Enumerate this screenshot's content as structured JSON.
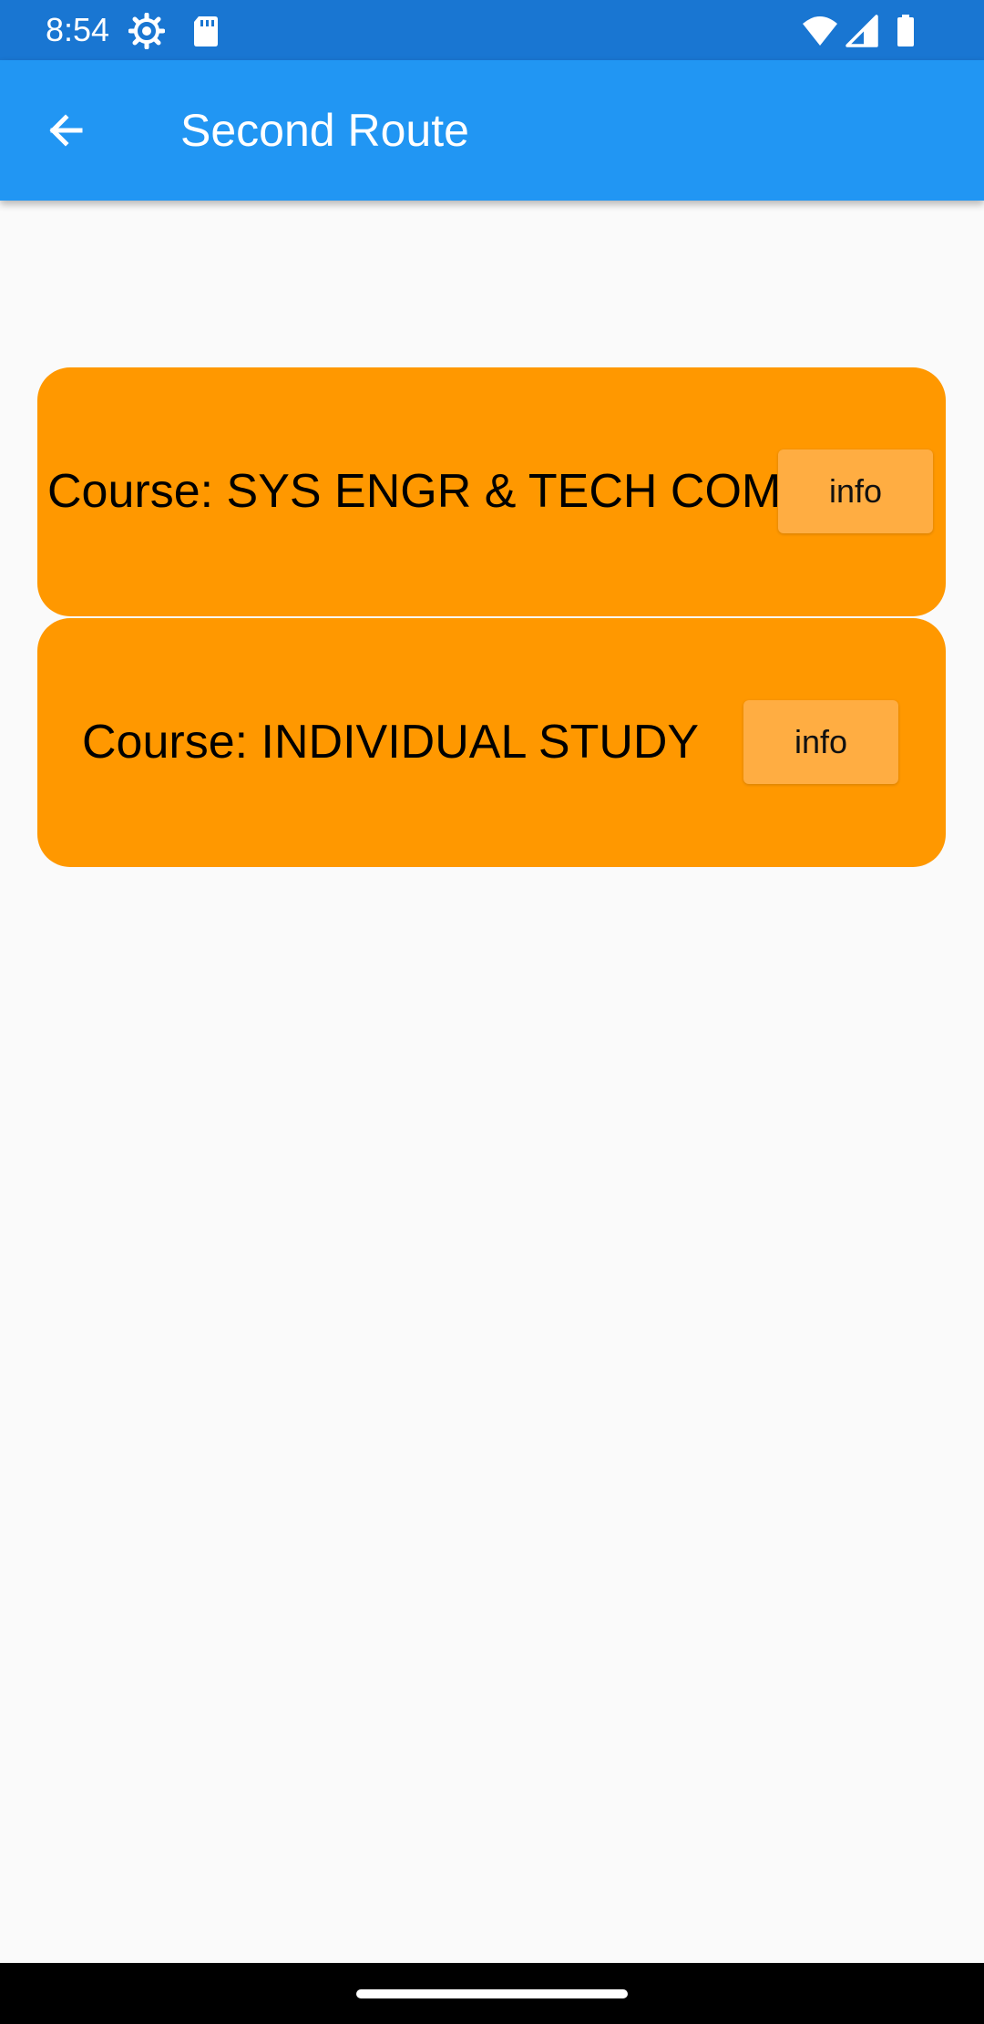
{
  "status_bar": {
    "time": "8:54",
    "icons": [
      "settings-gear-icon",
      "sd-card-icon",
      "wifi-icon",
      "cellular-signal-icon",
      "battery-icon"
    ]
  },
  "app_bar": {
    "back_icon": "arrow-back-icon",
    "title": "Second Route"
  },
  "courses": [
    {
      "label": "Course: SYS ENGR & TECH COM",
      "button": "info"
    },
    {
      "label": "Course: INDIVIDUAL STUDY",
      "button": "info"
    }
  ],
  "colors": {
    "status_bar": "#1976d2",
    "app_bar": "#2196f3",
    "card": "#ff9800",
    "info_button": "#ffad42",
    "background": "#fafafa"
  }
}
